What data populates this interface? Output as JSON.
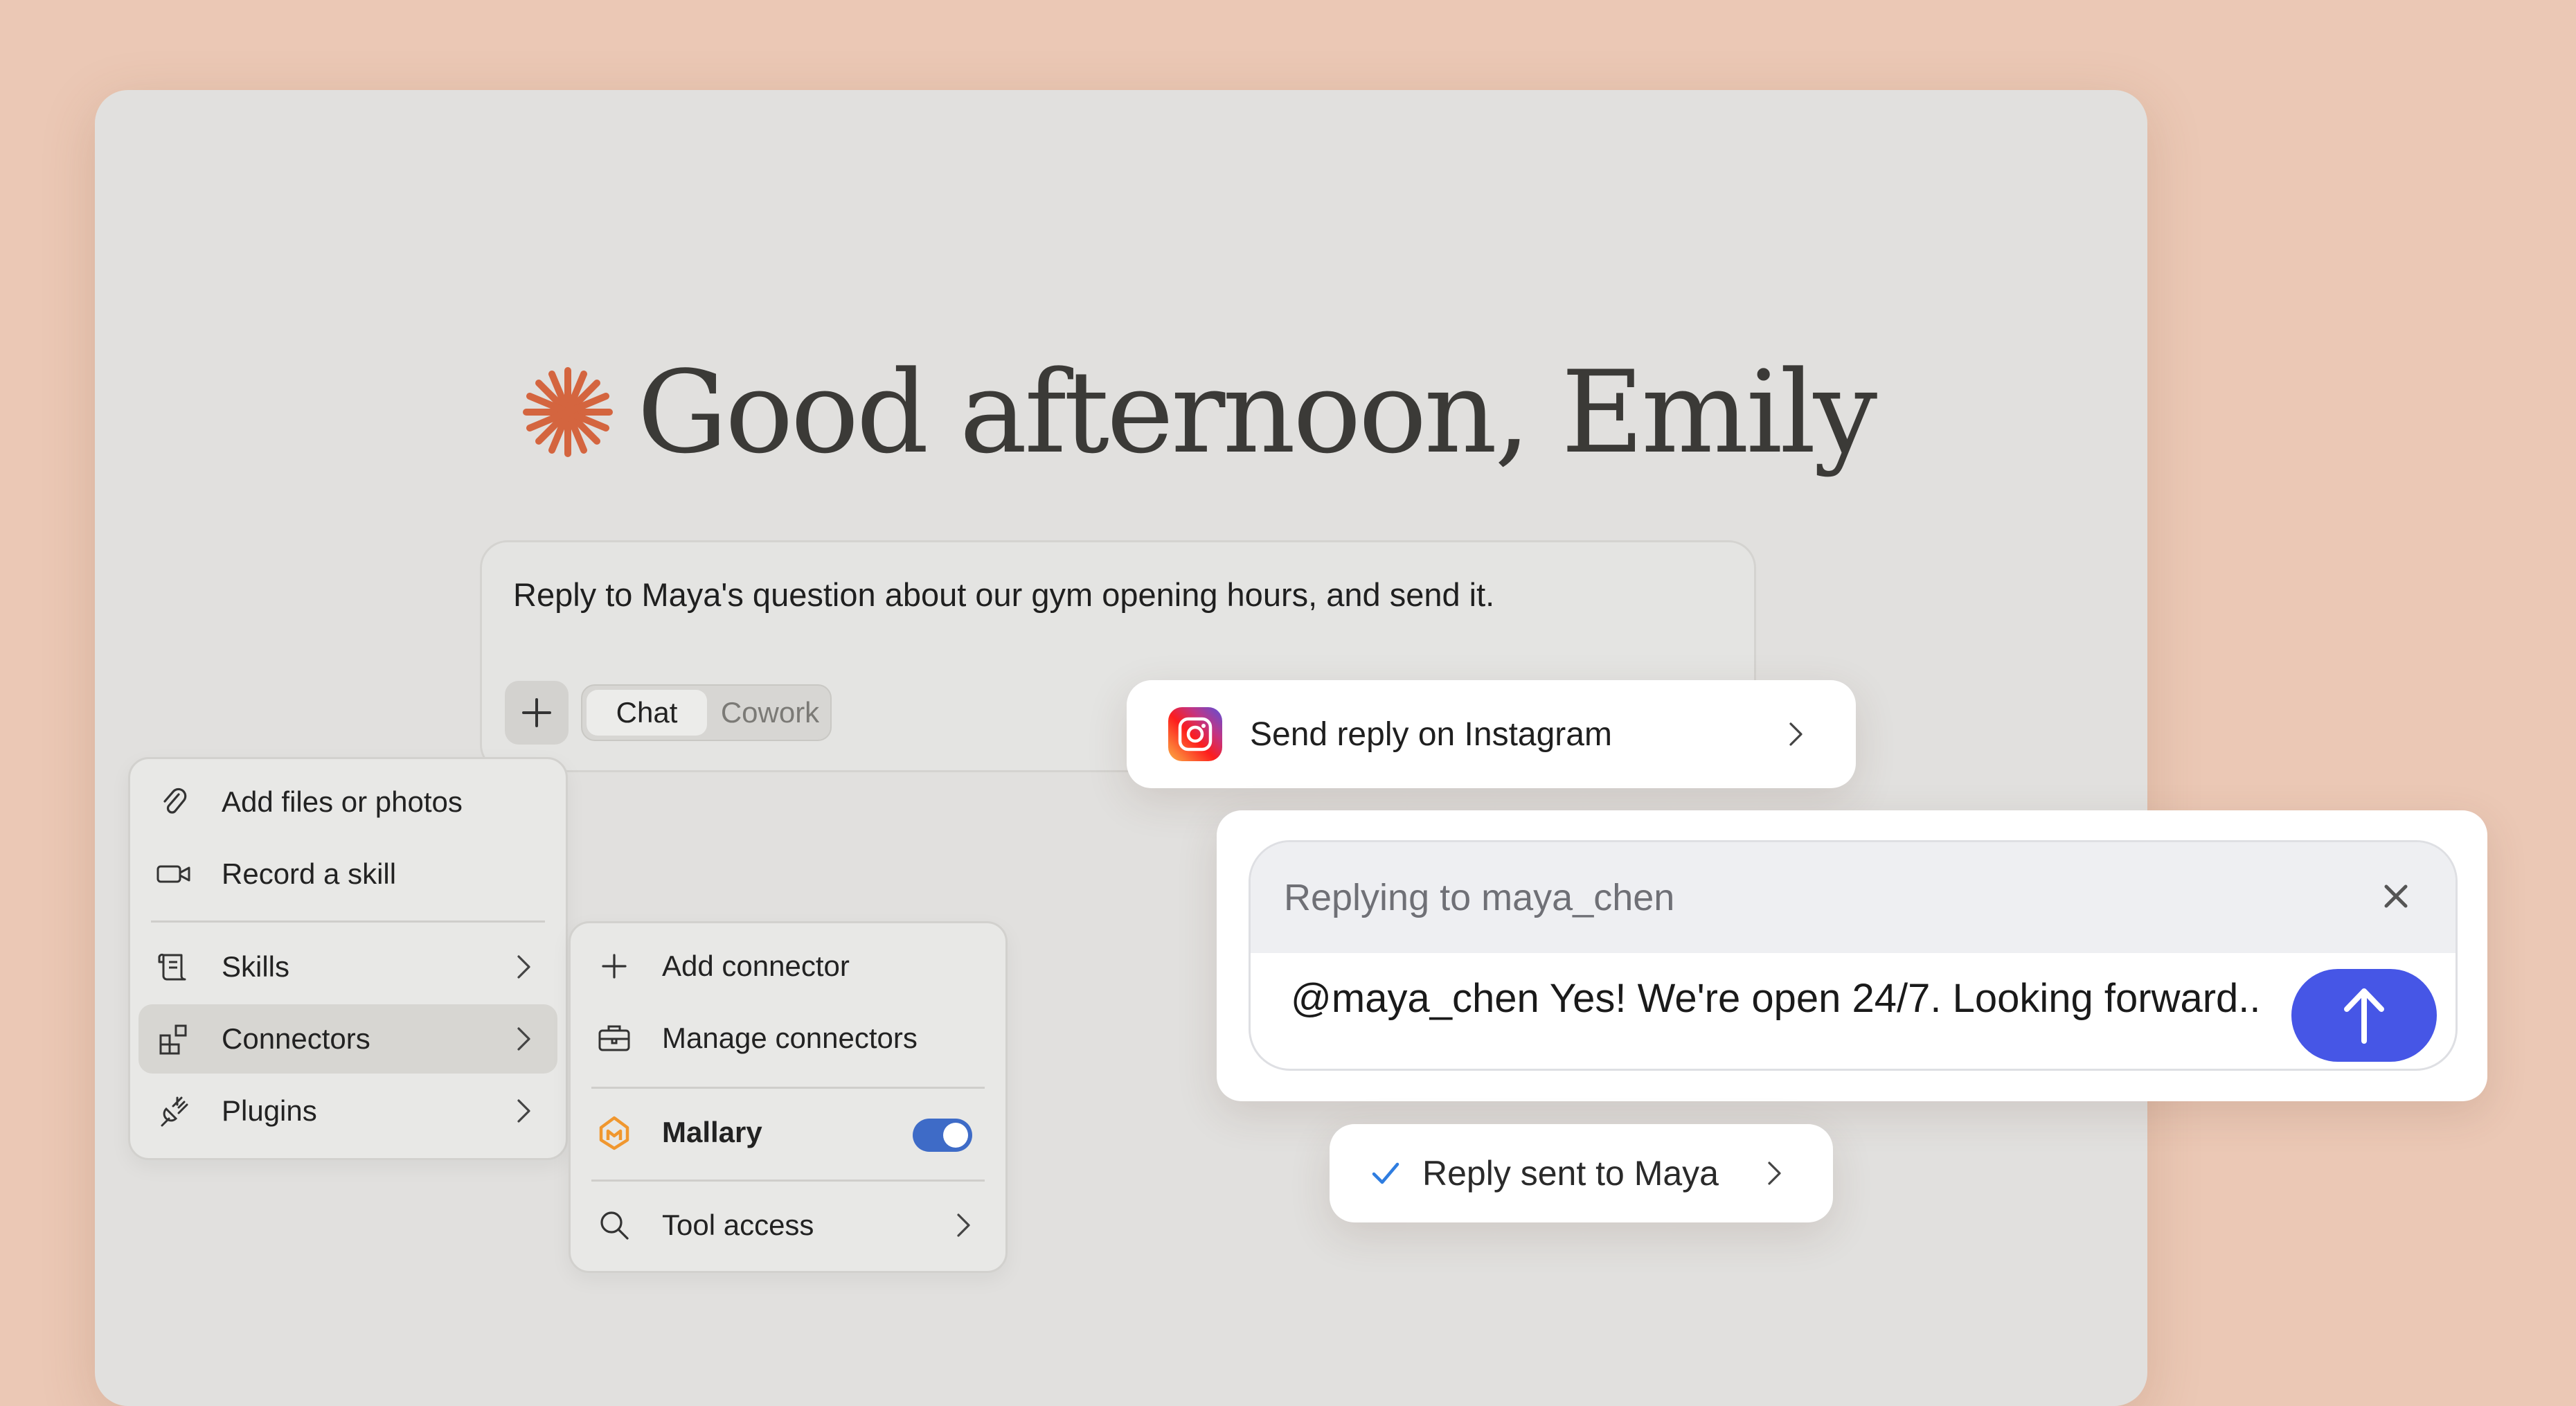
{
  "greeting": {
    "text": "Good afternoon, Emily",
    "accent_color": "#d4653f"
  },
  "composer": {
    "prompt": "Reply to Maya's question about our gym opening hours, and send it.",
    "modes": {
      "chat": "Chat",
      "cowork": "Cowork",
      "selected": "Chat"
    }
  },
  "attach_menu": {
    "items": [
      {
        "label": "Add files or photos",
        "icon": "paperclip-icon"
      },
      {
        "label": "Record a skill",
        "icon": "video-camera-icon"
      },
      {
        "label": "Skills",
        "icon": "scroll-icon"
      },
      {
        "label": "Connectors",
        "icon": "blocks-icon"
      },
      {
        "label": "Plugins",
        "icon": "plug-icon"
      }
    ]
  },
  "connectors_menu": {
    "add": "Add connector",
    "manage": "Manage connectors",
    "connector": {
      "name": "Mallary",
      "enabled": true
    },
    "tool_access": "Tool access"
  },
  "instagram_action": {
    "label": "Send reply on Instagram"
  },
  "reply": {
    "replying_to": "Replying to maya_chen",
    "message": "@maya_chen Yes! We're open 24/7. Looking forward..",
    "send_color": "#4656e6"
  },
  "status": {
    "label": "Reply sent to Maya"
  }
}
